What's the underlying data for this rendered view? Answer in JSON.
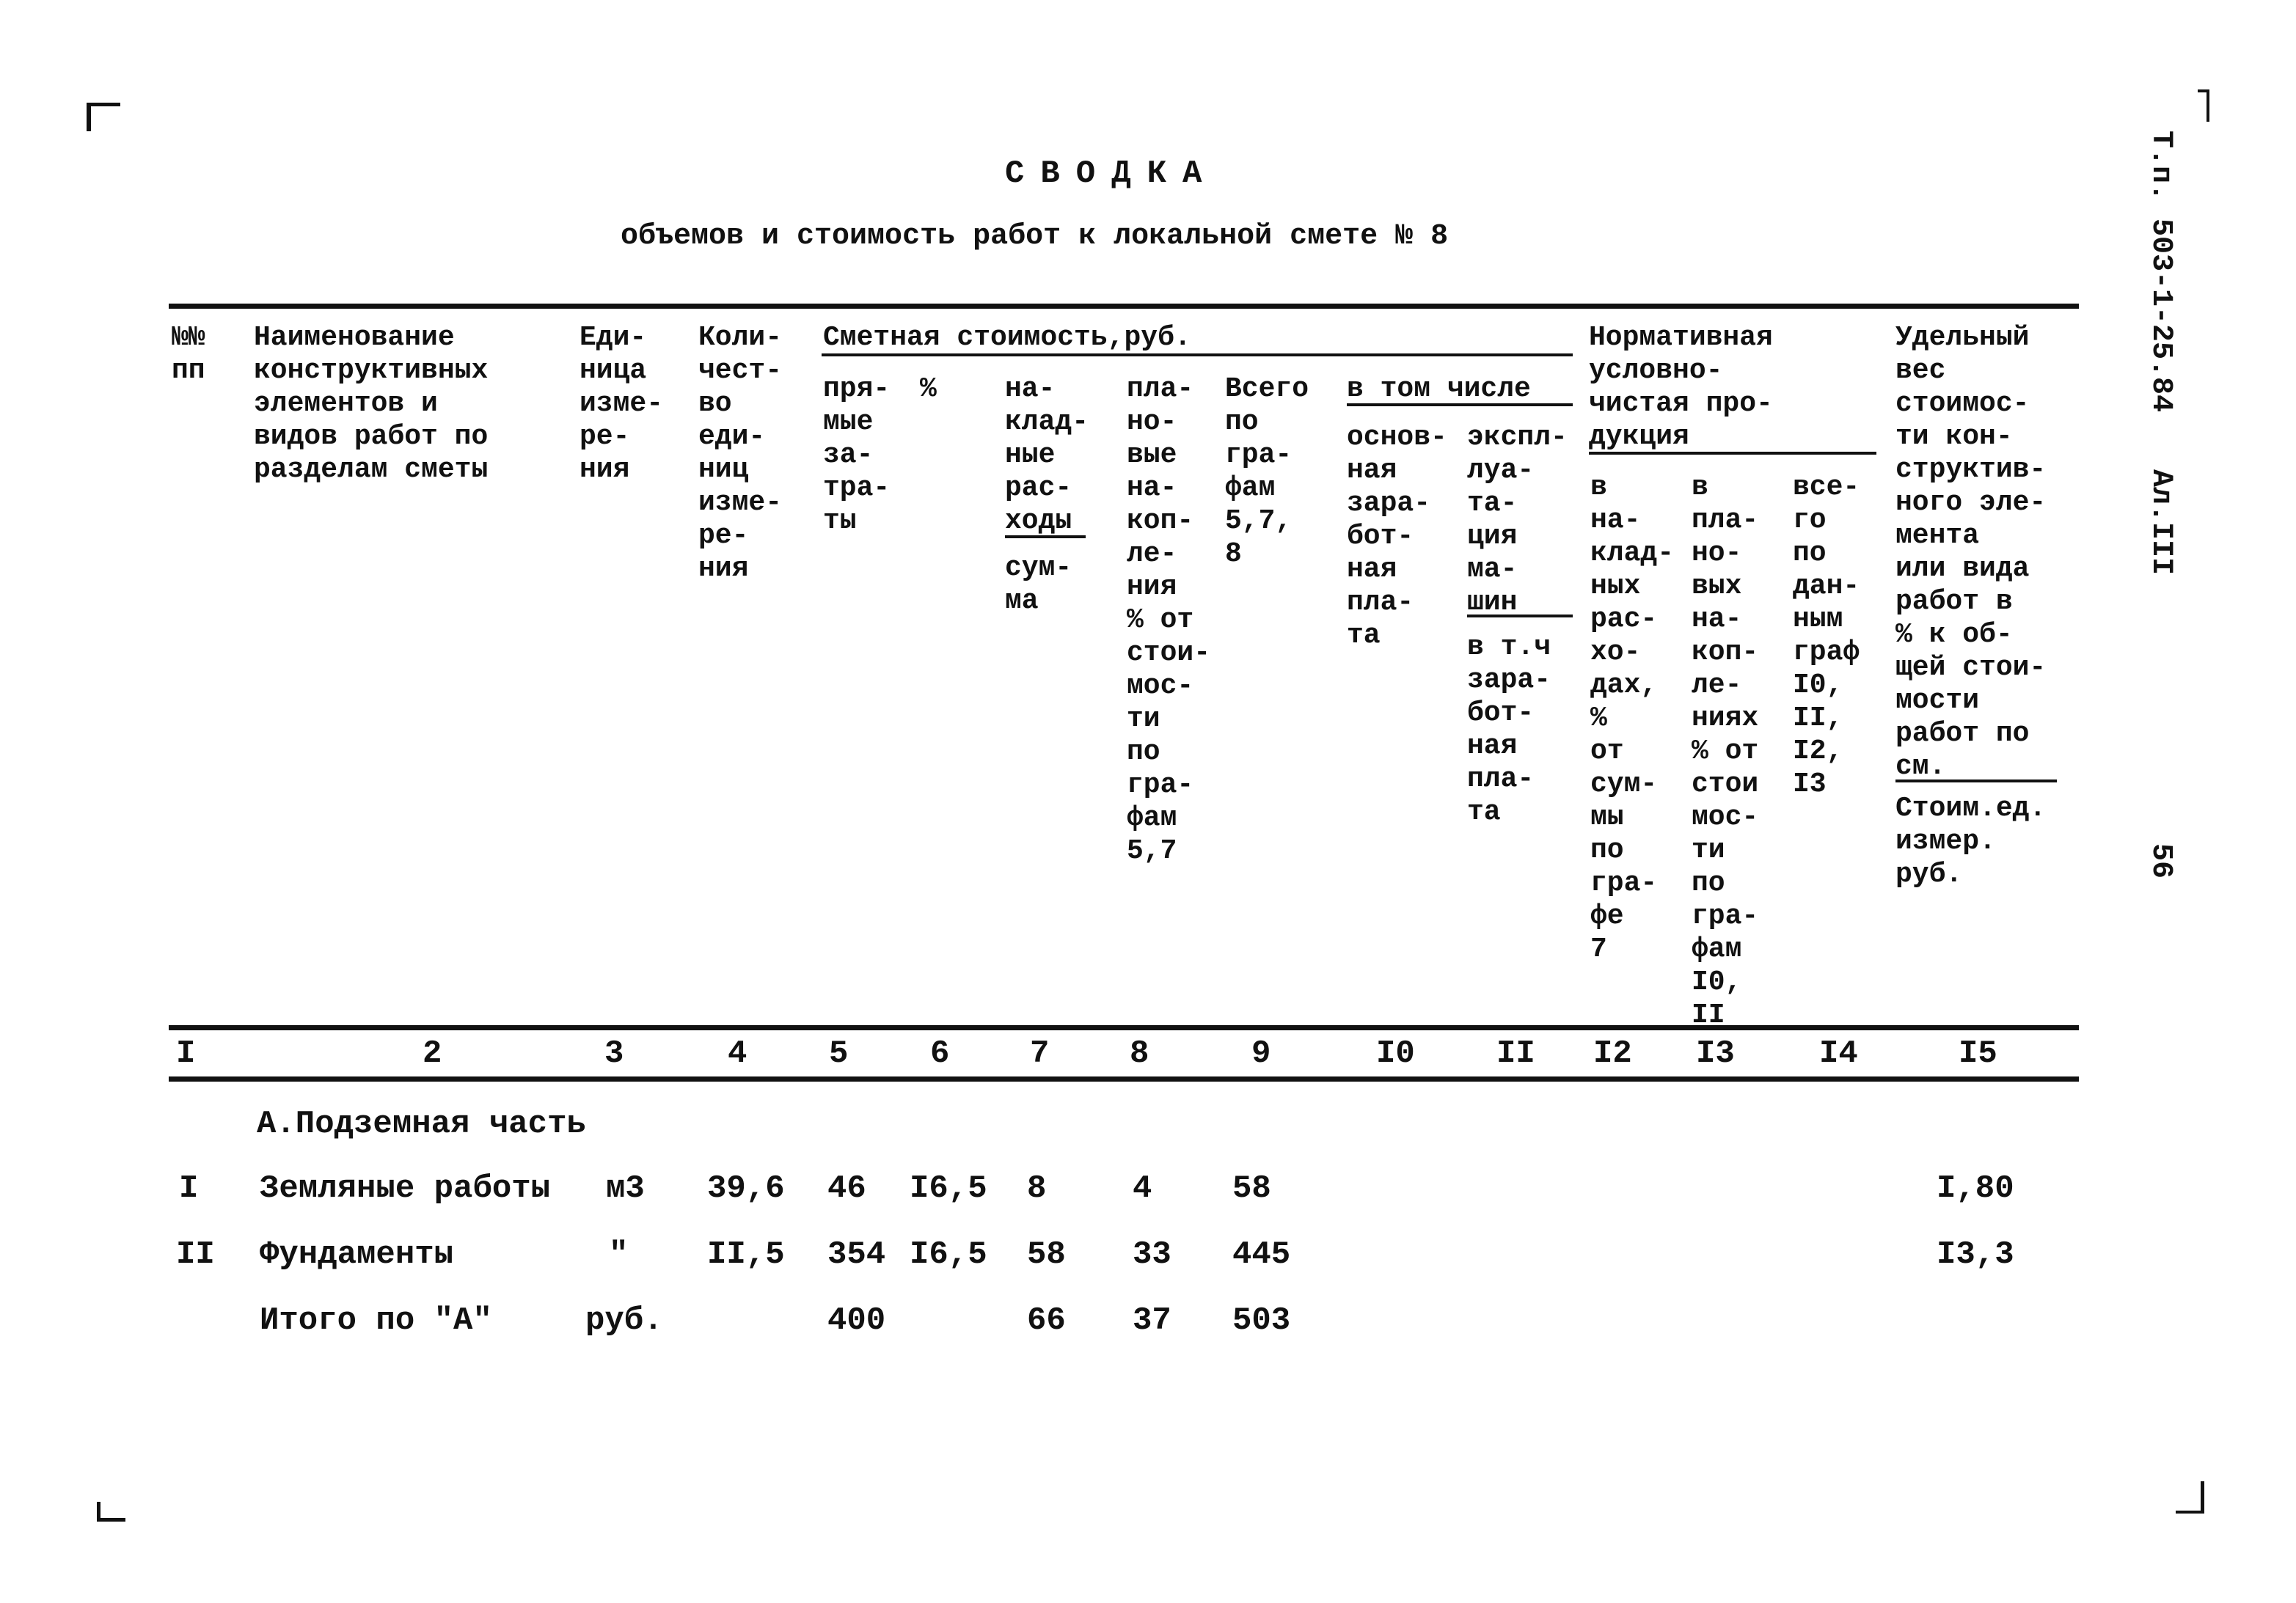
{
  "document": {
    "title": "СВОДКА",
    "subtitle": "объемов и стоимость работ к локальной смете № 8",
    "side_code": "Т.п. 503-1-25.84",
    "side_album": "Ал.III",
    "page_number": "56"
  },
  "table": {
    "header": {
      "num": "№№\nпп",
      "name": "Наименование\nконструктивных\nэлементов и\nвидов работ по\nразделам сметы",
      "unit": "Еди-\nница\nизме-\nре-\nния",
      "qty": "Коли-\nчест-\nво\nеди-\nниц\nизме-\nре-\nния",
      "cost_group": "Сметная стоимость,руб.",
      "direct": "пря-\nмые\nза-\nтра-\nты",
      "direct_pct": "%",
      "overhead_title": "на-\nклад-\nные\nрас-\nходы",
      "overhead_sum": "сум-\nма",
      "planned": "пла-\nно-\nвые\nна-\nкоп-\nле-\nния\n% от\nстои-\nмос-\nти\nпо\nгра-\nфам\n5,7",
      "total": "Всего\nпо\nгра-\nфам\n5,7,\n8",
      "incl_group": "в том числе",
      "base_wage": "основ-\nная\nзара-\nбот-\nная\nпла-\nта",
      "machine_title": "экспл-\nлуа-\nта-\nция\nма-\nшин",
      "machine_wage": "в т.ч\nзара-\nбот-\nная\nпла-\nта",
      "norm_group": "Нормативная\nусловно-\nчистая про-\nдукция",
      "norm_overhead": "в\nна-\nклад-\nных\nрас-\nхо-\nдах,\n%\nот\nсум-\nмы\nпо\nгра-\nфе\n7",
      "norm_planned": "в\nпла-\nно-\nвых\nна-\nкоп-\nле-\nниях\n% от\nстои\nмос-\nти\nпо\nгра-\nфам\nI0,\nII",
      "norm_total": "все-\nго\nпо\nдан-\nным\nграф\nI0,\nII,\nI2,\nI3",
      "share_title": "Удельный\nвес\nстоимос-\nти кон-\nструктив-\nного эле-\nмента\nили вида\nработ в\n% к об-\nщей стои-\nмости\nработ по\nсм.",
      "unit_cost": "Стоим.ед.\nизмер.\nруб."
    },
    "column_numbers": [
      "I",
      "2",
      "3",
      "4",
      "5",
      "6",
      "7",
      "8",
      "9",
      "I0",
      "II",
      "I2",
      "I3",
      "I4",
      "I5"
    ],
    "section_title": "А.Подземная часть",
    "rows": [
      {
        "num": "I",
        "name": "Земляные работы",
        "unit": "м3",
        "qty": "39,6",
        "c5": "46",
        "c6": "I6,5",
        "c7": "8",
        "c8": "4",
        "c9": "58",
        "c15": "I,80"
      },
      {
        "num": "II",
        "name": "Фундаменты",
        "unit": "\"",
        "qty": "II,5",
        "c5": "354",
        "c6": "I6,5",
        "c7": "58",
        "c8": "33",
        "c9": "445",
        "c15": "I3,3"
      },
      {
        "num": "",
        "name": "Итого по \"А\"",
        "unit": "руб.",
        "qty": "",
        "c5": "400",
        "c6": "",
        "c7": "66",
        "c8": "37",
        "c9": "503",
        "c15": ""
      }
    ]
  }
}
